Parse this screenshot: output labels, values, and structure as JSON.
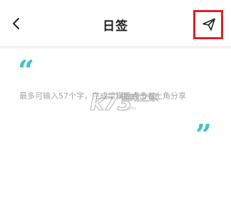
{
  "header": {
    "title": "日签",
    "back_icon": "chevron-left-icon",
    "share_icon": "paper-plane-icon",
    "highlight_color": "#d9232a"
  },
  "content": {
    "quote_open": "“",
    "quote_close": "”",
    "placeholder": "最多可输入57个字，完成编辑后点击右上角分享",
    "accent_color": "#3fc4c4"
  },
  "watermark": {
    "logo": "k73",
    "text": "游戏之家",
    "url": ".com"
  }
}
